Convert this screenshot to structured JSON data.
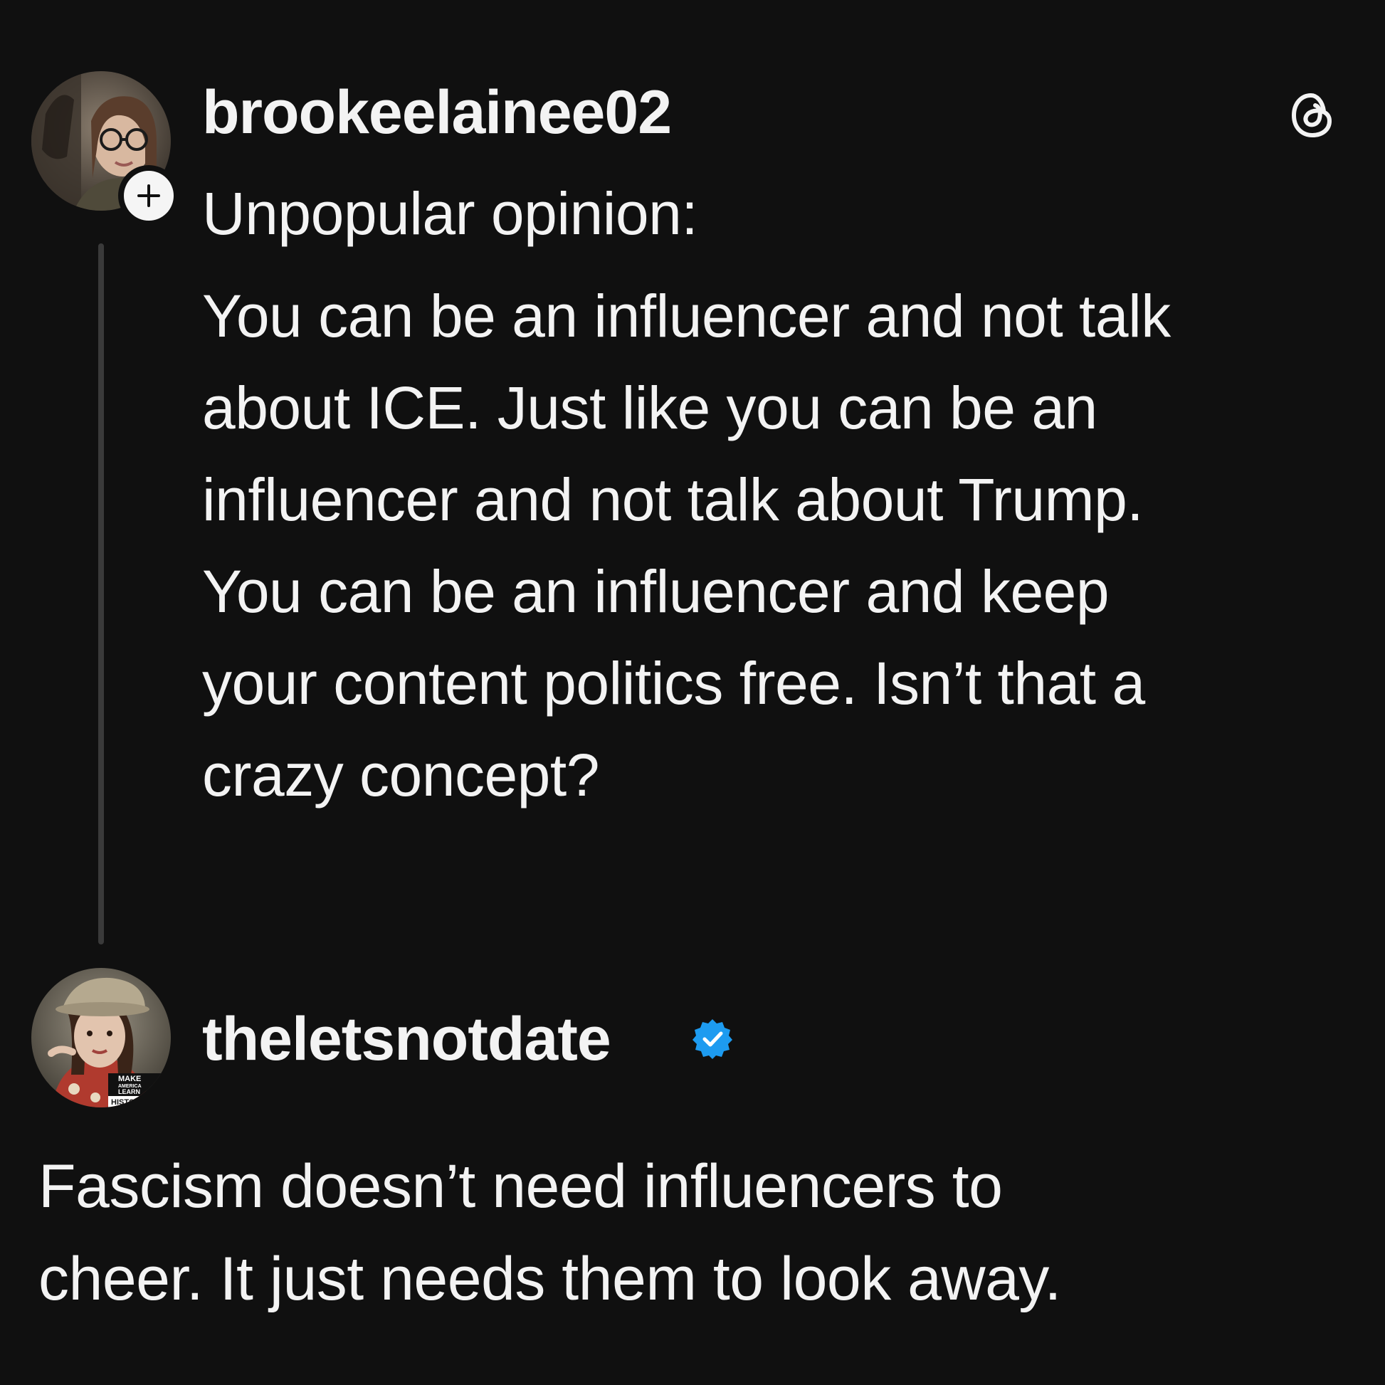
{
  "post": {
    "username": "brookeelainee02",
    "text_lines": [
      "Unpopular opinion:",
      "You can be an influencer and not talk",
      "about ICE. Just like you can be an",
      "influencer and not talk about Trump.",
      "You can be an influencer and keep",
      "your content politics free. Isn’t that a",
      "crazy concept?"
    ],
    "follow_icon": "plus-icon",
    "app_icon": "threads-logo-icon"
  },
  "reply": {
    "username": "theletsnotdate",
    "verified_icon": "verified-badge-icon",
    "verified_color": "#1d9bf0",
    "avatar_sign_lines": [
      "MAKE",
      "AMERICA",
      "LEARN",
      "HISTORY AGA"
    ],
    "text_lines": [
      "Fascism doesn’t need influencers to",
      "cheer. It just needs them to look away."
    ]
  },
  "colors": {
    "background": "#101010",
    "text": "#f3f3f3",
    "thread_line": "#3a3a3a"
  }
}
